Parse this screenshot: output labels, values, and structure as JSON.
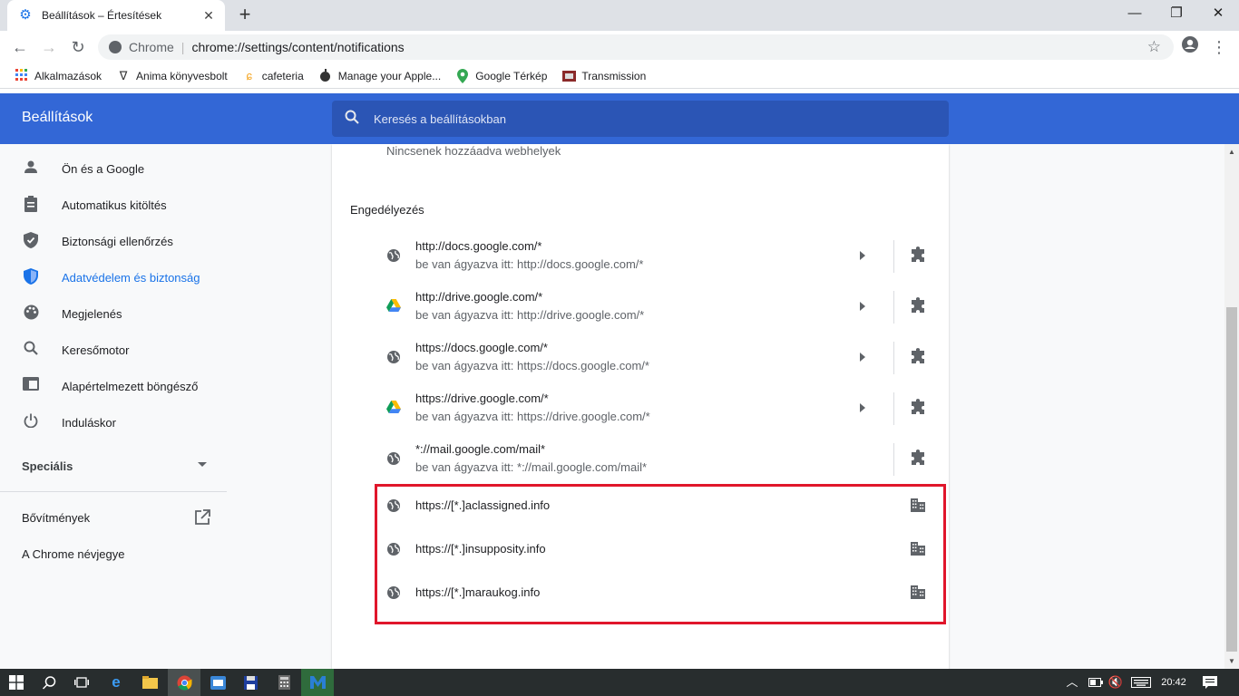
{
  "browser": {
    "tab_title": "Beállítások – Értesítések",
    "omnibox_host": "Chrome",
    "omnibox_url": "chrome://settings/content/notifications"
  },
  "bookmarks": [
    {
      "label": "Alkalmazások",
      "icon": "apps-grid-icon"
    },
    {
      "label": "Anima könyvesbolt",
      "icon": "anima-icon"
    },
    {
      "label": "cafeteria",
      "icon": "cafeteria-icon"
    },
    {
      "label": "Manage your Apple...",
      "icon": "apple-icon"
    },
    {
      "label": "Google Térkép",
      "icon": "maps-pin-icon"
    },
    {
      "label": "Transmission",
      "icon": "transmission-icon"
    }
  ],
  "header": {
    "title": "Beállítások",
    "search_placeholder": "Keresés a beállításokban"
  },
  "sidebar": {
    "items": [
      {
        "label": "Ön és a Google",
        "icon": "person-icon"
      },
      {
        "label": "Automatikus kitöltés",
        "icon": "clipboard-icon"
      },
      {
        "label": "Biztonsági ellenőrzés",
        "icon": "shield-check-icon"
      },
      {
        "label": "Adatvédelem és biztonság",
        "icon": "shield-icon",
        "active": true
      },
      {
        "label": "Megjelenés",
        "icon": "palette-icon"
      },
      {
        "label": "Keresőmotor",
        "icon": "search-icon"
      },
      {
        "label": "Alapértelmezett böngésző",
        "icon": "browser-icon"
      },
      {
        "label": "Induláskor",
        "icon": "power-icon"
      }
    ],
    "advanced": "Speciális",
    "extensions": "Bővítmények",
    "about": "A Chrome névjegye"
  },
  "content": {
    "no_sites": "Nincsenek hozzáadva webhelyek",
    "allow_title": "Engedélyezés",
    "allowed": [
      {
        "site": "http://docs.google.com/*",
        "embedded": "be van ágyazva itt: http://docs.google.com/*",
        "icon": "globe-icon",
        "has_arrow": true
      },
      {
        "site": "http://drive.google.com/*",
        "embedded": "be van ágyazva itt: http://drive.google.com/*",
        "icon": "google-drive-icon",
        "has_arrow": true
      },
      {
        "site": "https://docs.google.com/*",
        "embedded": "be van ágyazva itt: https://docs.google.com/*",
        "icon": "globe-icon",
        "has_arrow": true
      },
      {
        "site": "https://drive.google.com/*",
        "embedded": "be van ágyazva itt: https://drive.google.com/*",
        "icon": "google-drive-icon",
        "has_arrow": true
      },
      {
        "site": "*://mail.google.com/mail*",
        "embedded": "be van ágyazva itt: *://mail.google.com/mail*",
        "icon": "globe-icon",
        "has_arrow": false
      }
    ],
    "policy_sites": [
      {
        "site": "https://[*.]aclassigned.info"
      },
      {
        "site": "https://[*.]insupposity.info"
      },
      {
        "site": "https://[*.]maraukog.info"
      }
    ]
  },
  "taskbar": {
    "time": "20:42"
  },
  "colors": {
    "header_bg": "#3367d6",
    "active_accent": "#1a73e8",
    "highlight_border": "#e0162b"
  }
}
